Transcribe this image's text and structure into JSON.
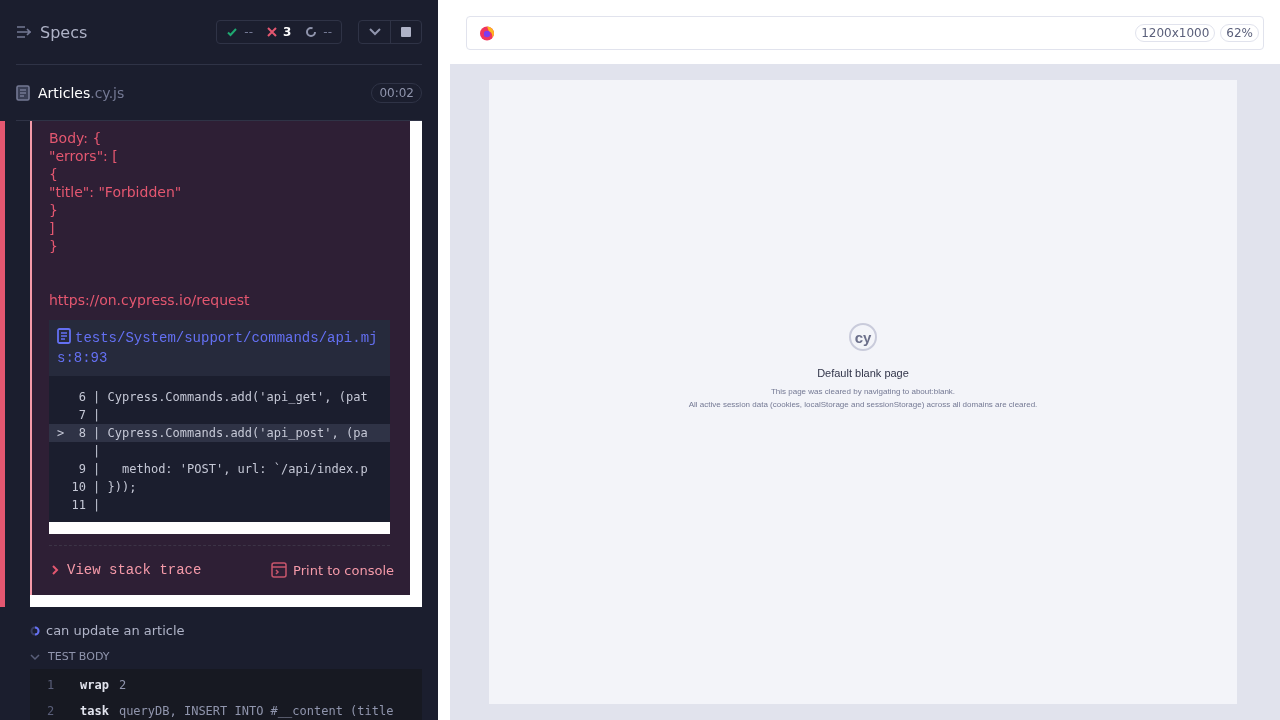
{
  "reporter": {
    "title": "Specs",
    "stats": [
      {
        "kind": "passed",
        "count": "--"
      },
      {
        "kind": "failed",
        "count": "3"
      },
      {
        "kind": "pending",
        "count": "--"
      }
    ],
    "spec": {
      "name": "Articles",
      "extension": ".cy.js",
      "duration": "00:02"
    },
    "error": {
      "message_lines": [
        "Body: {",
        "\"errors\": [",
        "{",
        "\"title\": \"Forbidden\"",
        "}",
        "]",
        "}"
      ],
      "link": "https://on.cypress.io/request",
      "code_frame": {
        "file": "tests/System/support/commands/api.mjs:8:93",
        "lines": [
          {
            "text": "   6 | Cypress.Commands.add('api_get', (pat",
            "highlighted": false
          },
          {
            "text": "   7 |",
            "highlighted": false
          },
          {
            "text": ">  8 | Cypress.Commands.add('api_post', (pa",
            "highlighted": true
          },
          {
            "text": "     |",
            "highlighted": false
          },
          {
            "text": "   9 |   method: 'POST', url: `/api/index.p",
            "highlighted": false
          },
          {
            "text": "  10 | }));",
            "highlighted": false
          },
          {
            "text": "  11 |",
            "highlighted": false
          }
        ]
      },
      "actions": [
        {
          "kind": "stack",
          "label": "View stack trace"
        },
        {
          "kind": "console",
          "label": "Print to console"
        }
      ]
    },
    "test": {
      "title": "can update an article",
      "running": true
    },
    "hook": {
      "title": "TEST BODY",
      "expanded": true
    },
    "commands": [
      {
        "number": "1",
        "name": "wrap",
        "message": "2"
      },
      {
        "number": "2",
        "name": "task",
        "message": "queryDB, INSERT INTO #__content (title"
      }
    ]
  },
  "preview": {
    "viewport": "1200x1000",
    "zoom": "62%",
    "logo_text": "cy",
    "title": "Default blank page",
    "lines": [
      "This page was cleared by navigating to about:blank.",
      "All active session data (cookies, localStorage and sessionStorage) across all domains are cleared."
    ]
  }
}
